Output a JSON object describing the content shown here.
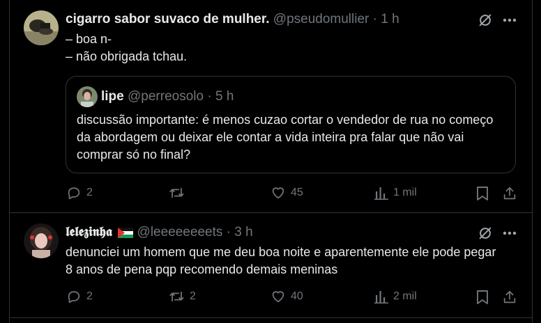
{
  "tweets": [
    {
      "name": "cigarro sabor suvaco de mulher.",
      "handle": "@pseudomullier",
      "sep": "·",
      "time": "1 h",
      "text": "– boa n-\n– não obrigada tchau.",
      "quote": {
        "name": "lipe",
        "handle": "@perreosolo",
        "sep": "·",
        "time": "5 h",
        "text": "discussão importante: é menos cuzao  cortar o vendedor de rua no começo da abordagem ou deixar ele contar a vida inteira pra falar que não vai comprar só no final?"
      },
      "replies": "2",
      "retweets": "",
      "likes": "45",
      "views": "1 mil"
    },
    {
      "name": "𝖑𝖊𝖑𝖊𝖟𝖎𝖓𝖍𝖆",
      "flag": "palestine-flag",
      "handle": "@leeeeeeeets",
      "sep": "·",
      "time": "3 h",
      "text": "denunciei um homem que me deu boa noite e aparentemente ele pode pegar 8 anos de pena pqp recomendo demais meninas",
      "replies": "2",
      "retweets": "2",
      "likes": "40",
      "views": "2 mil"
    }
  ],
  "colors": {
    "background": "#000000",
    "text": "#e7e9ea",
    "muted": "#71767b",
    "border": "#2f3336",
    "grok": "#a1a6ab"
  },
  "icons": [
    "grok-icon",
    "more-icon",
    "reply-icon",
    "retweet-icon",
    "like-icon",
    "views-icon",
    "bookmark-icon",
    "share-icon"
  ]
}
